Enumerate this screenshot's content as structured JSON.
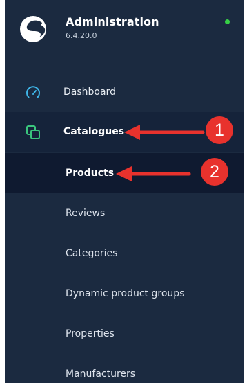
{
  "app": {
    "title": "Administration",
    "version": "6.4.20.0",
    "status_color": "#37d046",
    "logo_icon": "shopware-logo-icon"
  },
  "nav": {
    "dashboard": {
      "label": "Dashboard",
      "icon": "gauge-icon"
    },
    "catalogues": {
      "label": "Catalogues",
      "icon": "catalogue-icon"
    }
  },
  "submenu": [
    {
      "label": "Products",
      "active": true
    },
    {
      "label": "Reviews"
    },
    {
      "label": "Categories"
    },
    {
      "label": "Dynamic product groups"
    },
    {
      "label": "Properties"
    },
    {
      "label": "Manufacturers"
    }
  ],
  "annotations": {
    "step1": "1",
    "step2": "2",
    "accent_color": "#e8322d"
  }
}
